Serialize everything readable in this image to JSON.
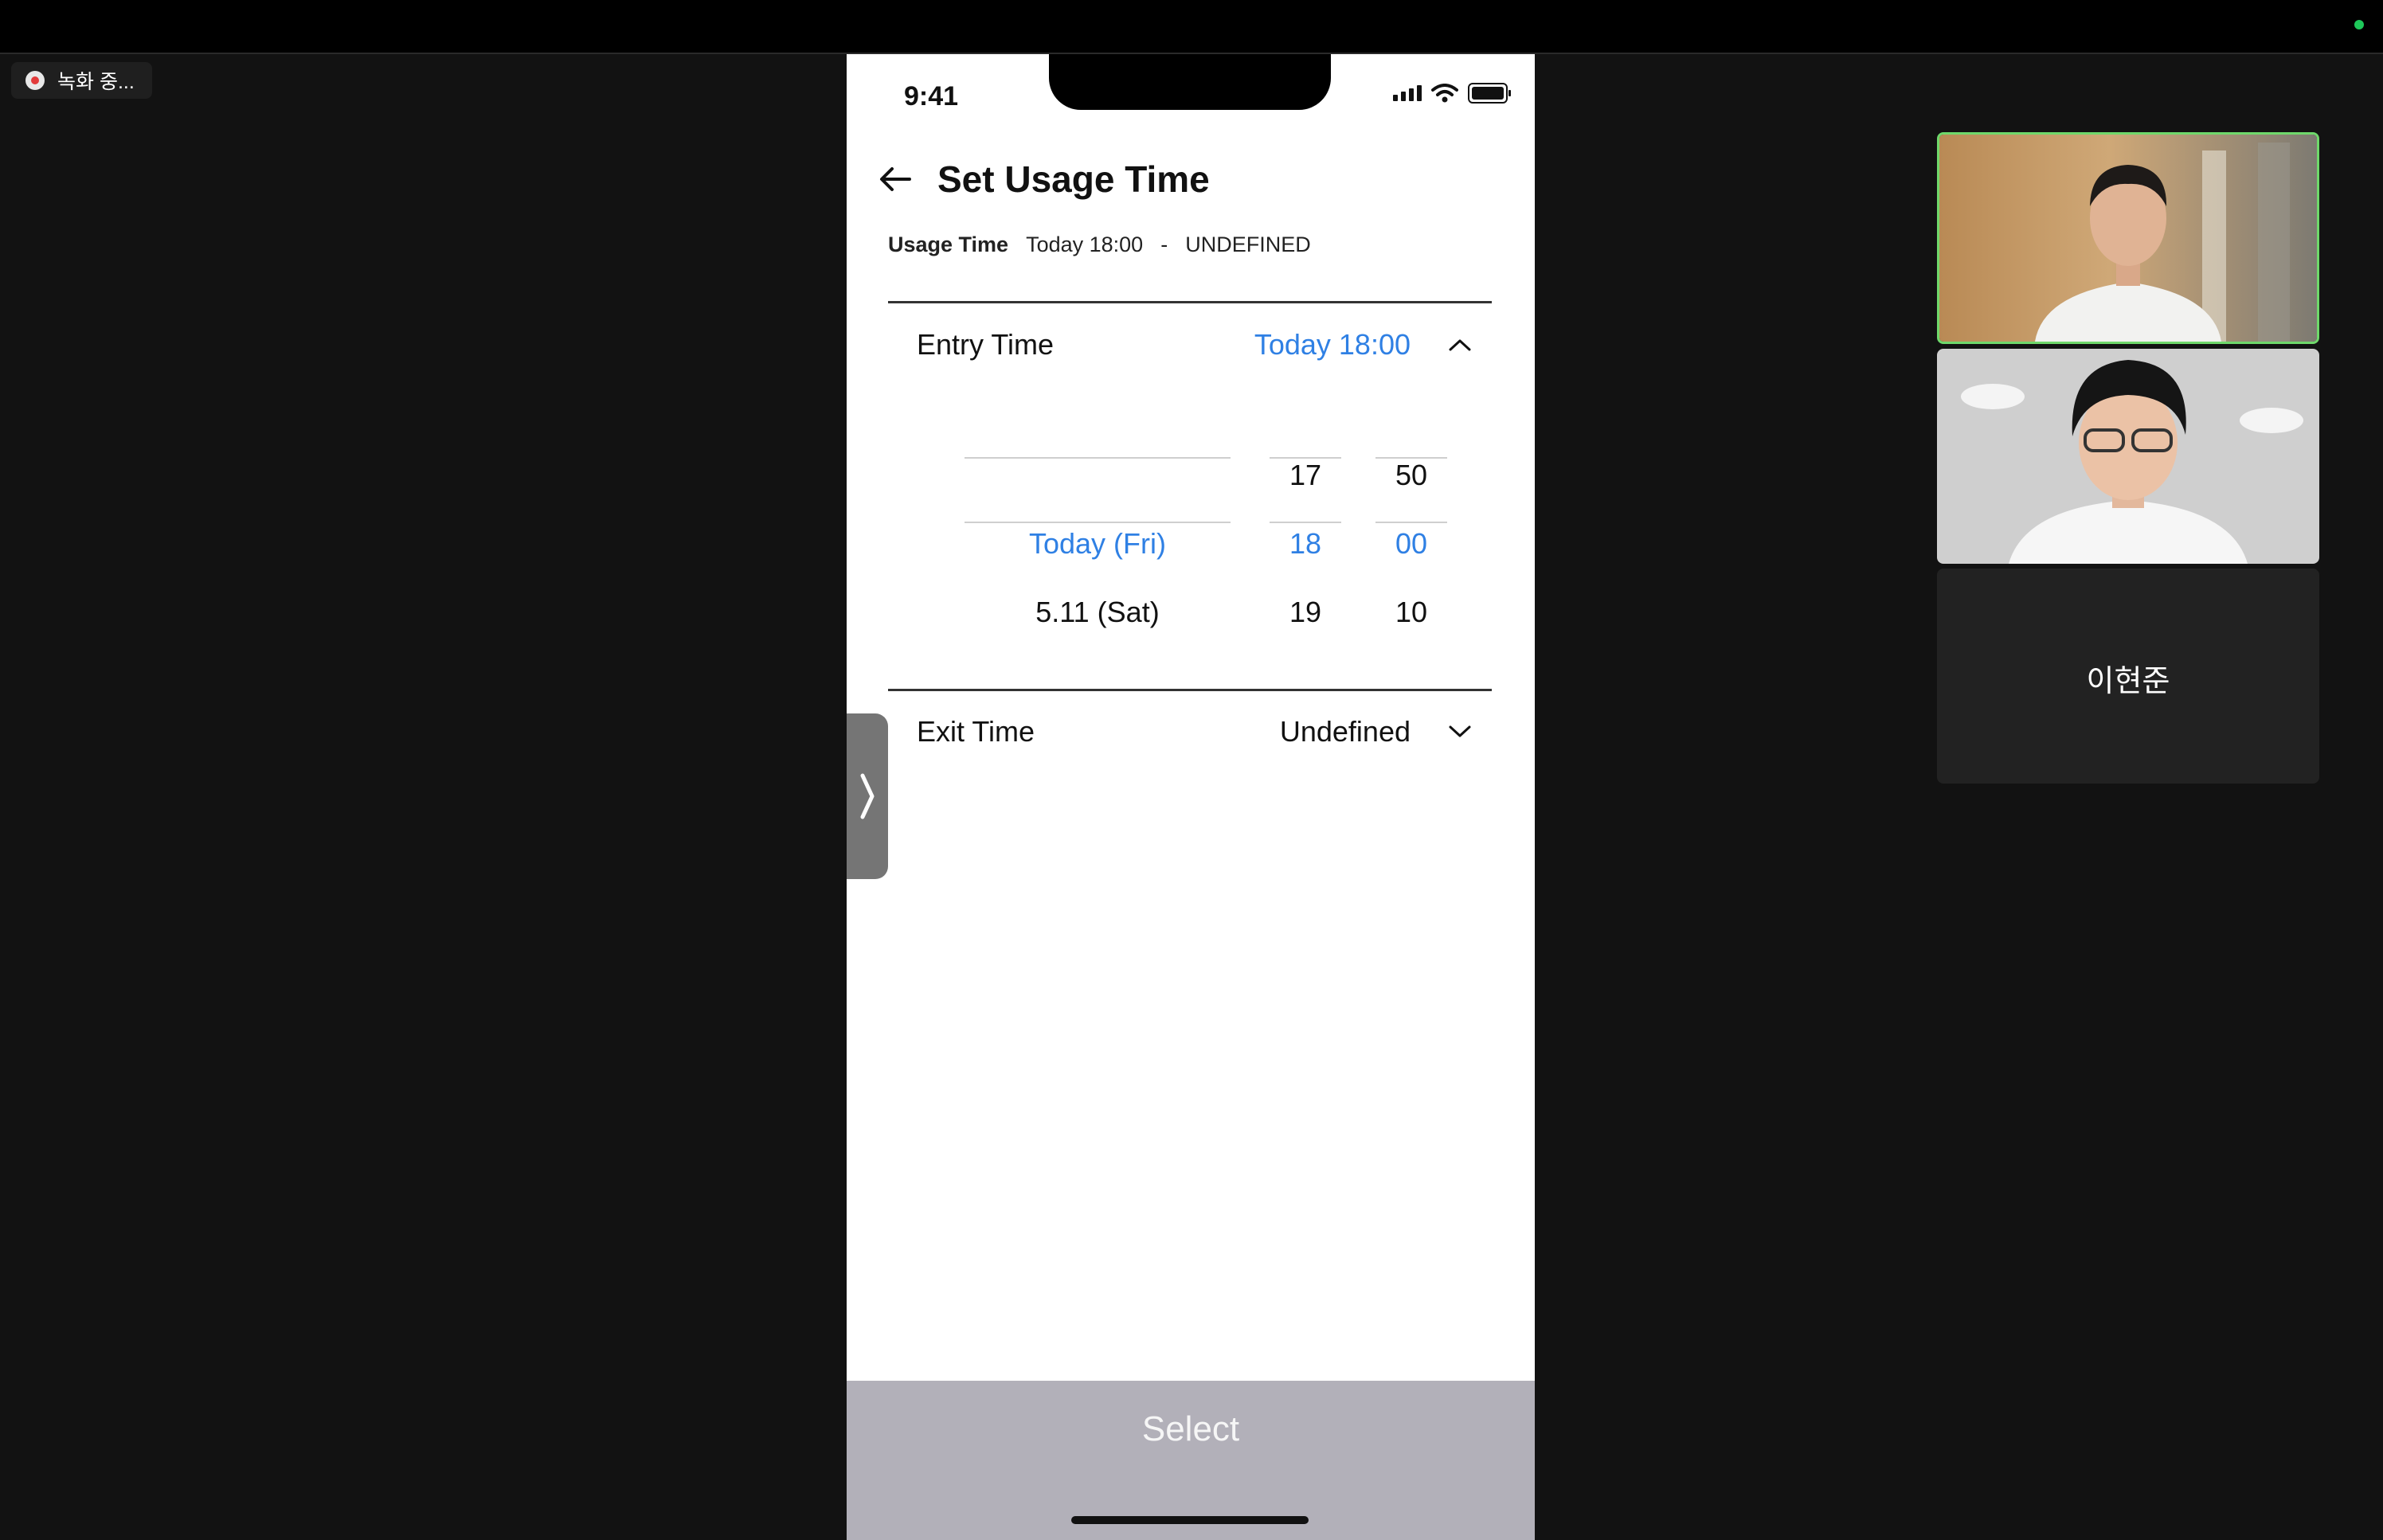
{
  "recording": {
    "label": "녹화 중..."
  },
  "status_bar": {
    "time": "9:41"
  },
  "header": {
    "title": "Set Usage Time"
  },
  "usage": {
    "label": "Usage Time",
    "start": "Today 18:00",
    "separator": "-",
    "end": "UNDEFINED"
  },
  "entry": {
    "label": "Entry Time",
    "value": "Today 18:00",
    "picker": {
      "dates": [
        "",
        "Today (Fri)",
        "5.11 (Sat)"
      ],
      "hours": [
        "17",
        "18",
        "19"
      ],
      "minutes": [
        "50",
        "00",
        "10"
      ],
      "selected_index": 1
    }
  },
  "exit": {
    "label": "Exit Time",
    "value": "Undefined"
  },
  "footer": {
    "select_label": "Select"
  },
  "participants": [
    {
      "type": "video",
      "active_speaker": true
    },
    {
      "type": "video",
      "active_speaker": false
    },
    {
      "type": "name",
      "name": "이현준"
    }
  ],
  "colors": {
    "accent": "#2f80e4",
    "speaker_border": "#6fd86b",
    "select_bar": "#b2b0b9"
  }
}
